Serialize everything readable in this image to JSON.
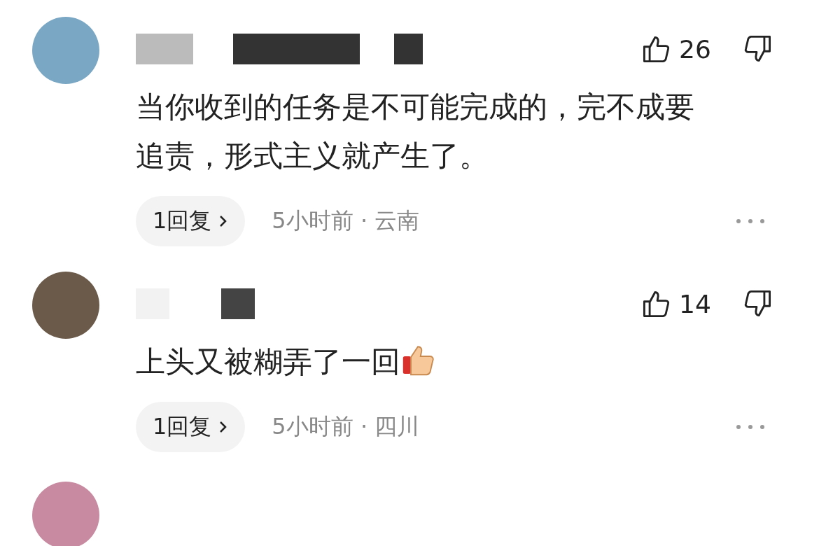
{
  "comments": [
    {
      "likes": "26",
      "text": "当你收到的任务是不可能完成的，完不成要追责，形式主义就产生了。",
      "emoji": false,
      "replies": "1回复",
      "meta": "5小时前 · 云南"
    },
    {
      "likes": "14",
      "text": "上头又被糊弄了一回",
      "emoji": true,
      "replies": "1回复",
      "meta": "5小时前 · 四川"
    }
  ]
}
